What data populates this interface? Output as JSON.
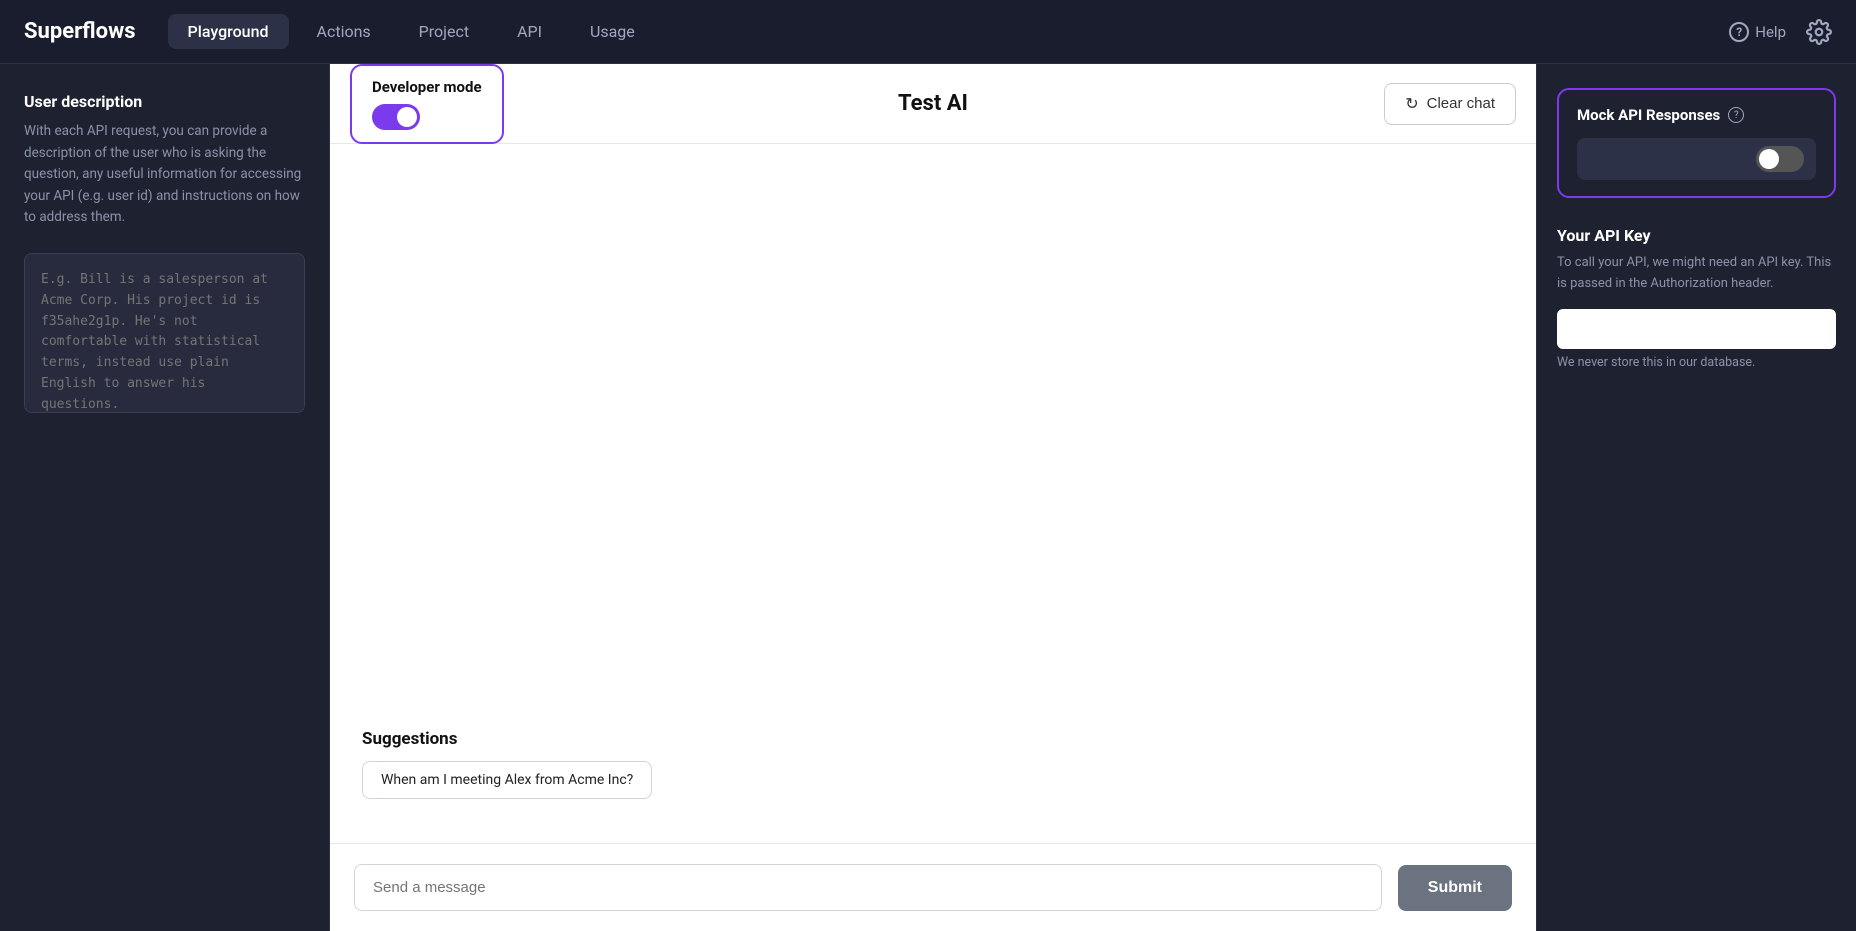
{
  "app": {
    "logo": "Superflows"
  },
  "nav": {
    "items": [
      {
        "label": "Playground",
        "active": true
      },
      {
        "label": "Actions",
        "active": false
      },
      {
        "label": "Project",
        "active": false
      },
      {
        "label": "API",
        "active": false
      },
      {
        "label": "Usage",
        "active": false
      }
    ],
    "help_label": "Help",
    "settings_label": "Settings"
  },
  "sidebar": {
    "title": "User description",
    "description": "With each API request, you can provide a description of the user who is asking the question, any useful information for accessing your API (e.g. user id) and instructions on how to address them.",
    "placeholder": "E.g. Bill is a salesperson at Acme Corp. His project id is f35ahe2g1p. He's not comfortable with statistical terms, instead use plain English to answer his questions."
  },
  "dev_mode": {
    "label": "Developer mode",
    "enabled": true
  },
  "chat": {
    "title": "Test AI",
    "clear_label": "Clear chat",
    "suggestions_label": "Suggestions",
    "suggestion_chip": "When am I meeting Alex from Acme Inc?",
    "input_placeholder": "Send a message",
    "submit_label": "Submit"
  },
  "mock_api": {
    "title": "Mock API Responses",
    "enabled": false
  },
  "api_key": {
    "title": "Your API Key",
    "description": "To call your API, we might need an API key. This is passed in the Authorization header.",
    "placeholder": "",
    "note": "We never store this in our database."
  },
  "colors": {
    "accent": "#7c3aed",
    "bg_dark": "#1e2130",
    "bg_header": "#1a1d2e",
    "border": "#2d3148"
  }
}
